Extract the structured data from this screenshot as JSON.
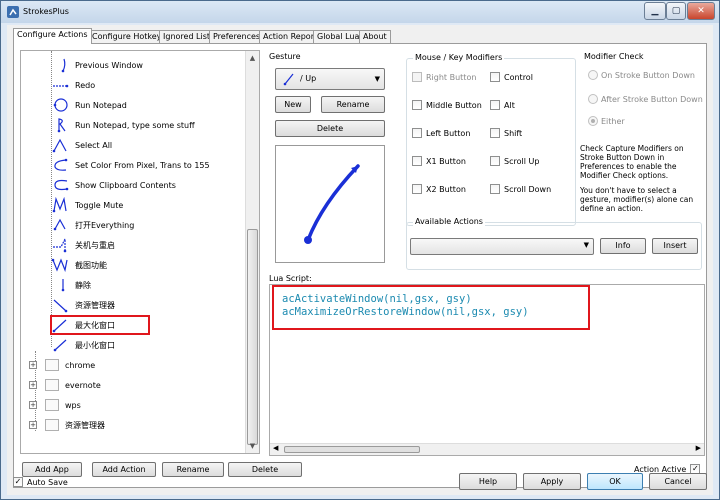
{
  "window": {
    "title": "StrokesPlus"
  },
  "title_buttons": {
    "minimize": "▁",
    "maximize": "▢",
    "close": "✕"
  },
  "tabs": [
    "Configure Actions",
    "Configure Hotkeys",
    "Ignored List",
    "Preferences",
    "Action Report",
    "Global Lua",
    "About"
  ],
  "tree": {
    "actions": [
      "Previous Window",
      "Redo",
      "Run Notepad",
      "Run Notepad, type some stuff",
      "Select All",
      "Set Color From Pixel, Trans to 155",
      "Show Clipboard Contents",
      "Toggle Mute",
      "打开Everything",
      "关机与重启",
      "截图功能",
      "静除",
      "资源管理器",
      "最大化窗口",
      "最小化窗口"
    ],
    "apps": [
      "chrome",
      "evernote",
      "wps",
      "资源管理器"
    ]
  },
  "bottom_buttons": {
    "add_app": "Add App",
    "add_action": "Add Action",
    "rename": "Rename",
    "delete": "Delete"
  },
  "gesture": {
    "section_label": "Gesture",
    "selected": "/ Up",
    "new_label": "New",
    "rename_label": "Rename",
    "delete_label": "Delete",
    "stroke_color": "#1a2fd6"
  },
  "modifiers": {
    "section_label": "Mouse / Key Modifiers",
    "items": [
      {
        "label": "Right Button",
        "checked": false,
        "disabled": true
      },
      {
        "label": "Control",
        "checked": false,
        "disabled": false
      },
      {
        "label": "Middle Button",
        "checked": false,
        "disabled": false
      },
      {
        "label": "Alt",
        "checked": false,
        "disabled": false
      },
      {
        "label": "Left Button",
        "checked": false,
        "disabled": false
      },
      {
        "label": "Shift",
        "checked": false,
        "disabled": false
      },
      {
        "label": "X1 Button",
        "checked": false,
        "disabled": false
      },
      {
        "label": "Scroll Up",
        "checked": false,
        "disabled": false
      },
      {
        "label": "X2 Button",
        "checked": false,
        "disabled": false
      },
      {
        "label": "Scroll Down",
        "checked": false,
        "disabled": false
      }
    ]
  },
  "modifier_check": {
    "section_label": "Modifier Check",
    "options": [
      "On Stroke Button Down",
      "After Stroke Button Down",
      "Either"
    ],
    "selected": "Either",
    "desc1": "Check Capture Modifiers on Stroke Button Down in Preferences to enable the Modifier Check options.",
    "desc2": "You don't have to select a gesture, modifier(s) alone can define an action."
  },
  "available_actions": {
    "section_label": "Available Actions",
    "info_label": "Info",
    "insert_label": "Insert"
  },
  "lua": {
    "label": "Lua Script:",
    "lines": [
      "acActivateWindow(nil,gsx, gsy)",
      "acMaximizeOrRestoreWindow(nil,gsx, gsy)"
    ]
  },
  "action_active": {
    "label": "Action Active",
    "checked": true
  },
  "footer": {
    "auto_save": "Auto Save",
    "auto_save_checked": true,
    "help": "Help",
    "apply": "Apply",
    "ok": "OK",
    "cancel": "Cancel"
  },
  "colors": {
    "highlight": "#e0161c",
    "code": "#1b8ab0"
  }
}
